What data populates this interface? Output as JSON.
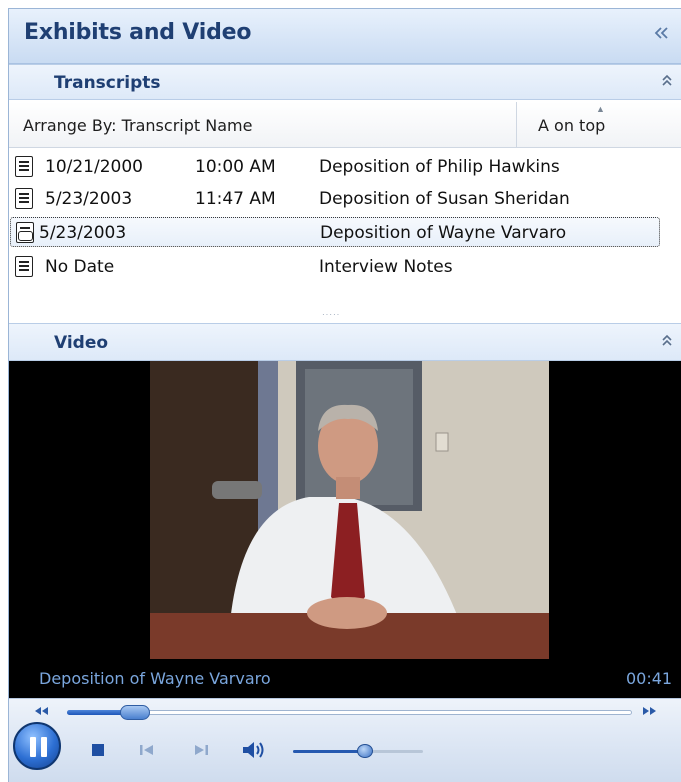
{
  "panel": {
    "title": "Exhibits and Video",
    "collapse_glyph": "«"
  },
  "transcripts": {
    "header": "Transcripts",
    "toggle_glyph": "⌃",
    "arrange_label": "Arrange By: Transcript Name",
    "sort_order": "A on top",
    "rows": [
      {
        "date": "10/21/2000",
        "time": "10:00 AM",
        "name": "Deposition of Philip Hawkins",
        "icon": "document-icon",
        "selected": false
      },
      {
        "date": "5/23/2003",
        "time": "11:47 AM",
        "name": "Deposition of Susan Sheridan",
        "icon": "document-icon",
        "selected": false
      },
      {
        "date": "5/23/2003",
        "time": "",
        "name": "Deposition of Wayne Varvaro",
        "icon": "video-document-icon",
        "selected": true
      },
      {
        "date": "No Date",
        "time": "",
        "name": "Interview Notes",
        "icon": "document-icon",
        "selected": false
      }
    ]
  },
  "video": {
    "header": "Video",
    "now_playing": "Deposition of Wayne Varvaro",
    "elapsed": "00:41",
    "seek_progress": 0.12,
    "volume_level": 0.55
  },
  "colors": {
    "title_text": "#1f3f73",
    "caption_text": "#7aa6dd",
    "accent": "#2659b0"
  }
}
